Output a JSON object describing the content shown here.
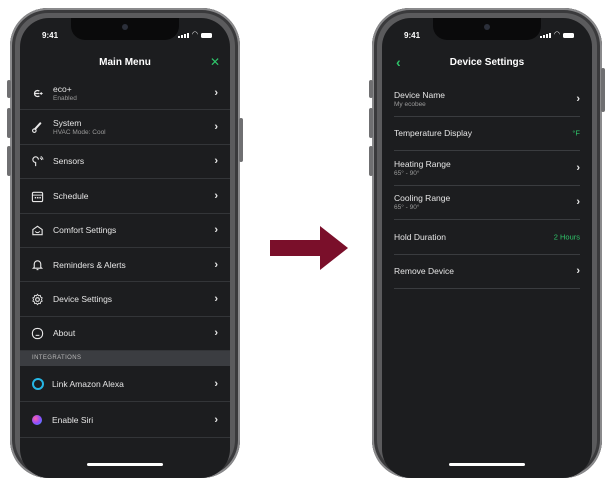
{
  "status_bar": {
    "time": "9:41"
  },
  "main_menu": {
    "title": "Main Menu",
    "close_icon": "✕",
    "items": [
      {
        "icon": "eco-plus-icon",
        "label": "eco+",
        "sublabel": "Enabled"
      },
      {
        "icon": "thermometer-icon",
        "label": "System",
        "sublabel": "HVAC Mode: Cool"
      },
      {
        "icon": "sensor-icon",
        "label": "Sensors",
        "sublabel": ""
      },
      {
        "icon": "calendar-icon",
        "label": "Schedule",
        "sublabel": ""
      },
      {
        "icon": "comfort-icon",
        "label": "Comfort Settings",
        "sublabel": ""
      },
      {
        "icon": "bell-icon",
        "label": "Reminders & Alerts",
        "sublabel": ""
      },
      {
        "icon": "gear-icon",
        "label": "Device Settings",
        "sublabel": ""
      },
      {
        "icon": "info-icon",
        "label": "About",
        "sublabel": ""
      }
    ],
    "integrations_header": "INTEGRATIONS",
    "integrations": [
      {
        "icon": "alexa-icon",
        "label": "Link Amazon Alexa"
      },
      {
        "icon": "siri-icon",
        "label": "Enable Siri"
      }
    ]
  },
  "device_settings": {
    "title": "Device Settings",
    "items": [
      {
        "label": "Device Name",
        "sublabel": "My ecobee",
        "value": "",
        "chevron": true
      },
      {
        "label": "Temperature Display",
        "sublabel": "",
        "value": "°F",
        "chevron": false
      },
      {
        "label": "Heating Range",
        "sublabel": "65° - 90°",
        "value": "",
        "chevron": true
      },
      {
        "label": "Cooling Range",
        "sublabel": "65° - 90°",
        "value": "",
        "chevron": true
      },
      {
        "label": "Hold Duration",
        "sublabel": "",
        "value": "2 Hours",
        "chevron": false
      },
      {
        "label": "Remove Device",
        "sublabel": "",
        "value": "",
        "chevron": true
      }
    ]
  },
  "colors": {
    "accent": "#2fc46a",
    "screen_bg": "#1c1d1f",
    "arrow": "#7a0f2a"
  }
}
